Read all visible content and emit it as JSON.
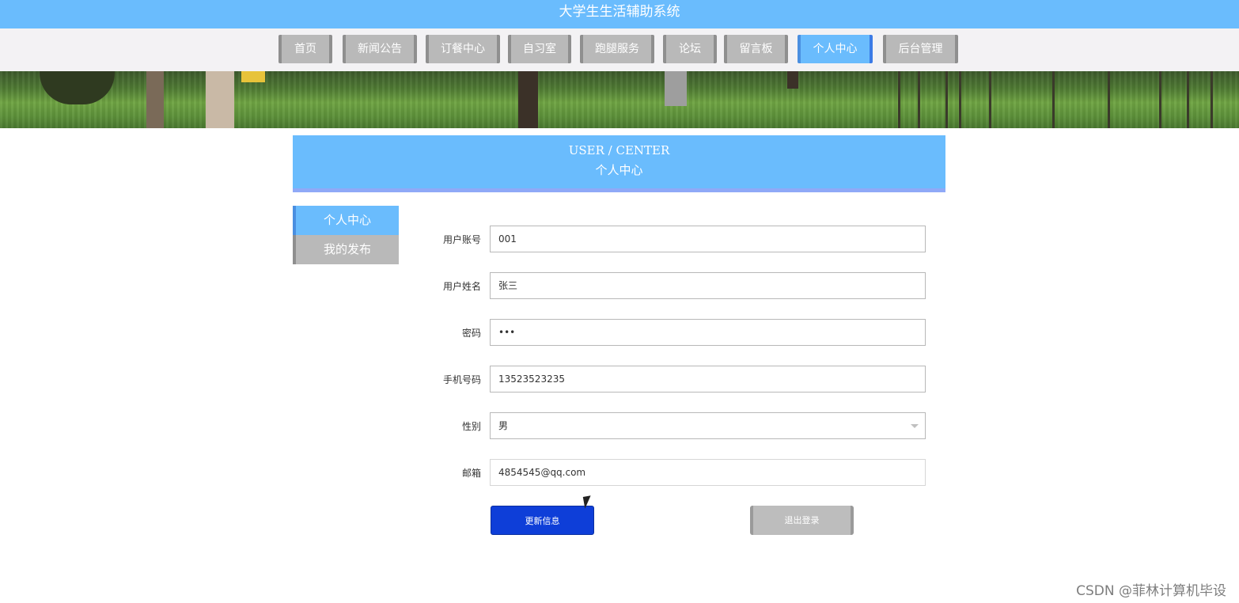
{
  "header": {
    "title": "大学生生活辅助系统"
  },
  "nav": {
    "items": [
      {
        "label": "首页"
      },
      {
        "label": "新闻公告"
      },
      {
        "label": "订餐中心"
      },
      {
        "label": "自习室"
      },
      {
        "label": "跑腿服务"
      },
      {
        "label": "论坛"
      },
      {
        "label": "留言板"
      },
      {
        "label": "个人中心",
        "active": true
      },
      {
        "label": "后台管理"
      }
    ]
  },
  "section": {
    "title_en": "USER / CENTER",
    "title_cn": "个人中心"
  },
  "sidebar": {
    "items": [
      {
        "label": "个人中心",
        "active": true
      },
      {
        "label": "我的发布",
        "active": false
      }
    ]
  },
  "form": {
    "account_label": "用户账号",
    "account_value": "001",
    "name_label": "用户姓名",
    "name_value": "张三",
    "password_label": "密码",
    "password_value": "•••",
    "phone_label": "手机号码",
    "phone_value": "13523523235",
    "gender_label": "性别",
    "gender_value": "男",
    "email_label": "邮箱",
    "email_value": "4854545@qq.com"
  },
  "buttons": {
    "update_label": "更新信息",
    "logout_label": "退出登录"
  },
  "watermark": "CSDN @菲林计算机毕设",
  "colors": {
    "primary": "#6abcfd",
    "button_primary": "#0e3ed8",
    "inactive": "#b9b9b9"
  }
}
